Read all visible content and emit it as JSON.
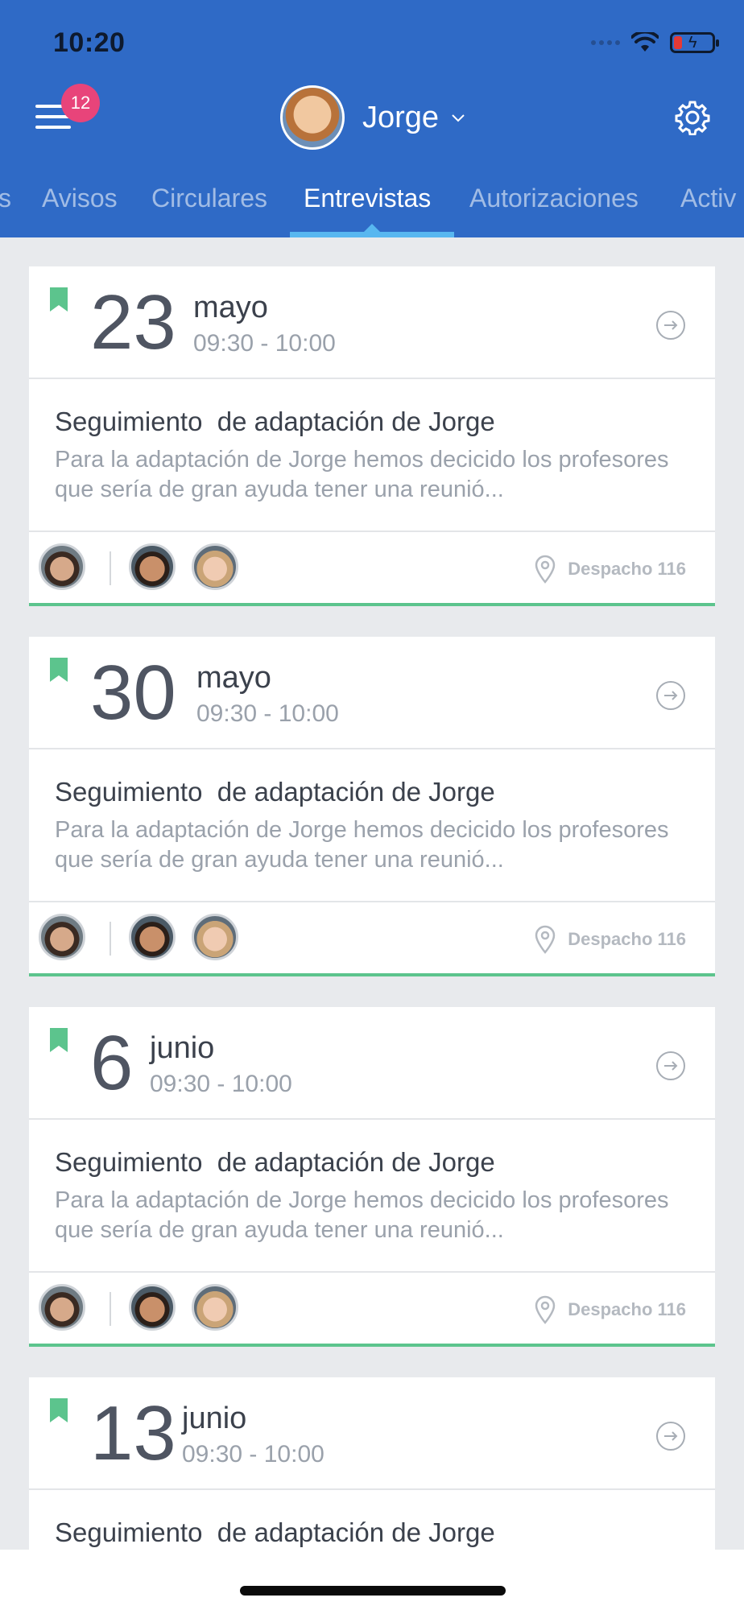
{
  "status": {
    "time": "10:20"
  },
  "header": {
    "notifications_count": "12",
    "profile_name": "Jorge"
  },
  "tabs": [
    {
      "label": "s"
    },
    {
      "label": "Avisos"
    },
    {
      "label": "Circulares"
    },
    {
      "label": "Entrevistas",
      "active": true
    },
    {
      "label": "Autorizaciones"
    },
    {
      "label": "Activ"
    }
  ],
  "interviews": [
    {
      "day": "23",
      "month": "mayo",
      "time": "09:30 - 10:00",
      "subject": "Seguimiento  de adaptación de Jorge",
      "description": "Para la adaptación de Jorge hemos decicido los profesores que sería de gran ayuda tener una reunió...",
      "location": "Despacho 116"
    },
    {
      "day": "30",
      "month": "mayo",
      "time": "09:30 - 10:00",
      "subject": "Seguimiento  de adaptación de Jorge",
      "description": "Para la adaptación de Jorge hemos decicido los profesores que sería de gran ayuda tener una reunió...",
      "location": "Despacho 116"
    },
    {
      "day": "6",
      "month": "junio",
      "time": "09:30 - 10:00",
      "subject": "Seguimiento  de adaptación de Jorge",
      "description": "Para la adaptación de Jorge hemos decicido los profesores que sería de gran ayuda tener una reunió...",
      "location": "Despacho 116"
    },
    {
      "day": "13",
      "month": "junio",
      "time": "09:30 - 10:00",
      "subject": "Seguimiento  de adaptación de Jorge"
    }
  ],
  "colors": {
    "header_bg": "#2f6ac6",
    "accent_green": "#5cc48d",
    "tab_underline": "#58b7f0",
    "badge": "#e8447a"
  }
}
